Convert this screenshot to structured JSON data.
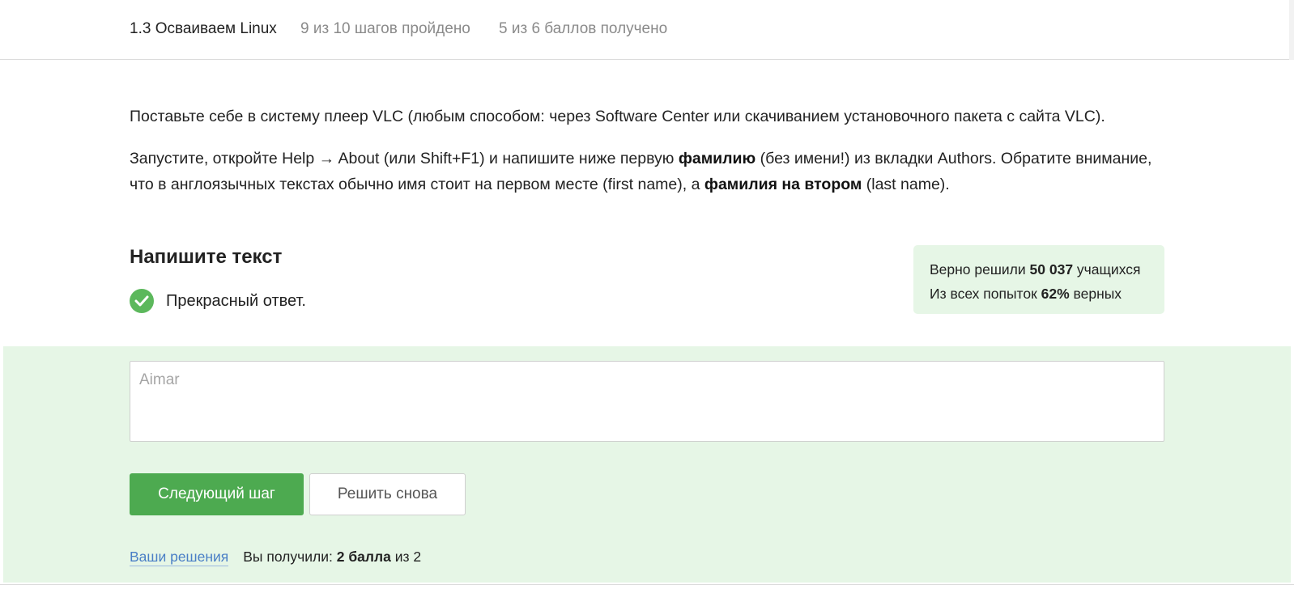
{
  "header": {
    "lesson_title": "1.3 Осваиваем Linux",
    "steps_progress": "9 из 10 шагов пройдено",
    "points_progress": "5 из 6 баллов  получено"
  },
  "task": {
    "paragraph1": "Поставьте себе в систему плеер VLC (любым способом: через Software Center или скачиванием установочного пакета с сайта VLC).",
    "p2_part1": "Запустите, откройте Help → About (или Shift+F1) и напишите ниже первую ",
    "p2_bold1": "фамилию",
    "p2_part2": " (без имени!) из вкладки Authors. Обратите внимание, что в англоязычных текстах обычно имя стоит на первом месте (first name), а ",
    "p2_bold2": "фамилия на втором",
    "p2_part3": " (last name)."
  },
  "quiz": {
    "title": "Напишите текст",
    "status_text": "Прекрасный ответ.",
    "answer_value": "Aimar"
  },
  "stats": {
    "solved_prefix": "Верно решили ",
    "solved_count": "50 037",
    "solved_suffix": " учащихся",
    "attempts_prefix": "Из всех попыток ",
    "attempts_percent": "62%",
    "attempts_suffix": " верных"
  },
  "actions": {
    "next_label": "Следующий шаг",
    "retry_label": "Решить снова"
  },
  "footer": {
    "solutions_link": "Ваши решения",
    "score_prefix": "Вы получили: ",
    "score_value": "2 балла",
    "score_suffix": " из 2"
  },
  "colors": {
    "accent_green": "#4daa50",
    "success_bg": "#e6f6e6",
    "link_blue": "#4a7fc6"
  }
}
